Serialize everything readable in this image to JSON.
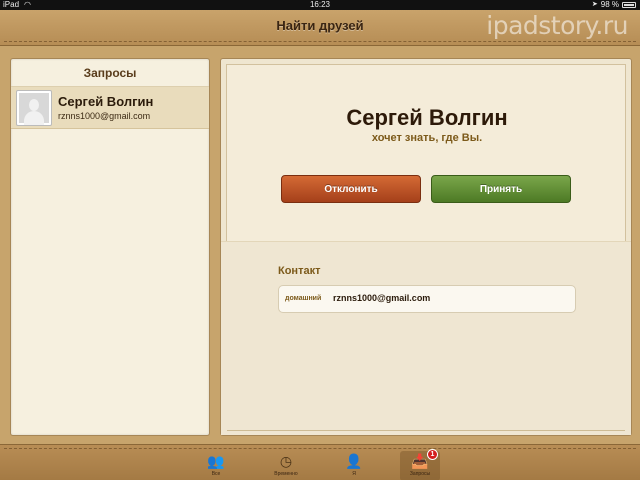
{
  "status_bar": {
    "carrier": "iPad",
    "time": "16:23",
    "battery_percent": "98 %"
  },
  "header": {
    "title": "Найти друзей",
    "watermark": "ipadstory.ru"
  },
  "sidebar": {
    "title": "Запросы",
    "items": [
      {
        "name": "Сергей Волгин",
        "email": "rznns1000@gmail.com"
      }
    ]
  },
  "detail": {
    "name": "Сергей Волгин",
    "subtitle": "хочет знать, где Вы.",
    "decline_label": "Отклонить",
    "accept_label": "Принять",
    "contact_title": "Контакт",
    "contact": {
      "type": "домашний",
      "value": "rznns1000@gmail.com"
    }
  },
  "tab_bar": {
    "tabs": [
      {
        "label": "Все",
        "icon": "people-icon"
      },
      {
        "label": "Временно",
        "icon": "clock-icon"
      },
      {
        "label": "Я",
        "icon": "person-icon"
      },
      {
        "label": "Запросы",
        "icon": "inbox-icon",
        "badge": "1"
      }
    ]
  },
  "colors": {
    "decline": "#b84c22",
    "accept": "#5f8c33",
    "leather": "#c7a46c"
  }
}
